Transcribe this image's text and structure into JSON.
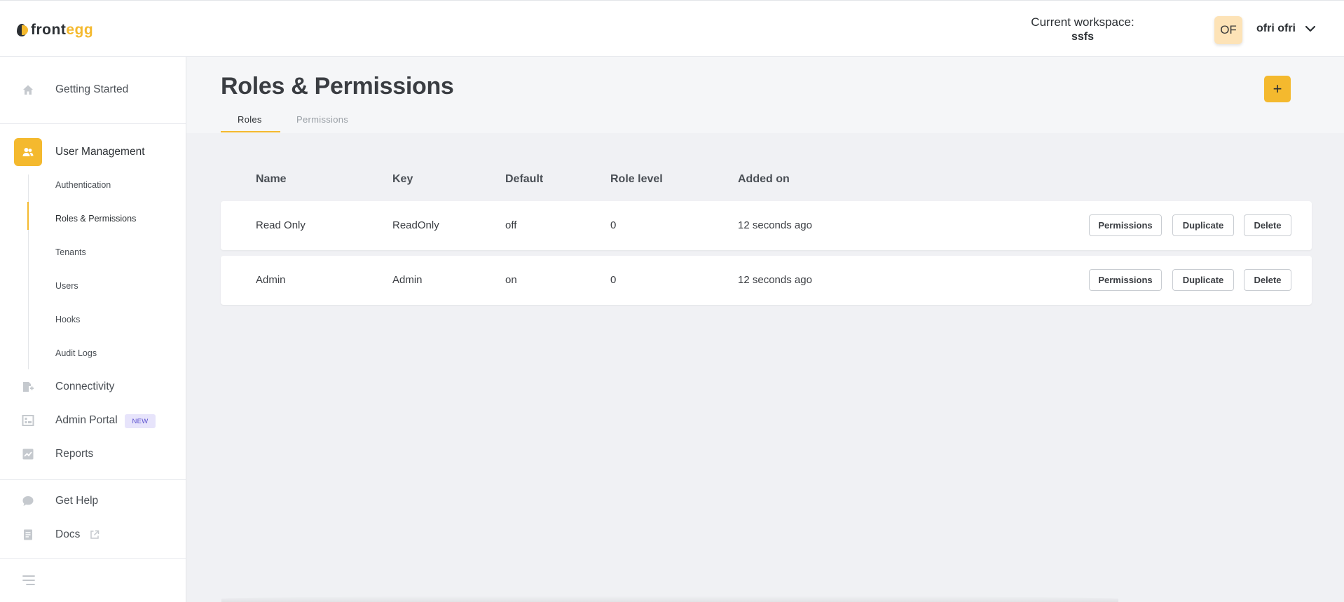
{
  "app": {
    "logo_text_1": "front",
    "logo_text_2": "egg"
  },
  "header": {
    "workspace_label": "Current workspace:",
    "workspace_name": "ssfs",
    "avatar_initials": "OF",
    "username": "ofri ofri"
  },
  "sidebar": {
    "getting_started": "Getting Started",
    "user_management": "User Management",
    "sub_items": [
      "Authentication",
      "Roles & Permissions",
      "Tenants",
      "Users",
      "Hooks",
      "Audit Logs"
    ],
    "connectivity": "Connectivity",
    "admin_portal": "Admin Portal",
    "new_badge": "NEW",
    "reports": "Reports",
    "get_help": "Get Help",
    "docs": "Docs"
  },
  "page": {
    "title": "Roles & Permissions",
    "add_label": "+",
    "tabs": [
      {
        "label": "Roles",
        "active": true
      },
      {
        "label": "Permissions",
        "active": false
      }
    ]
  },
  "table": {
    "columns": [
      "Name",
      "Key",
      "Default",
      "Role level",
      "Added on"
    ],
    "rows": [
      {
        "name": "Read Only",
        "key": "ReadOnly",
        "default": "off",
        "role_level": "0",
        "added_on": "12 seconds ago"
      },
      {
        "name": "Admin",
        "key": "Admin",
        "default": "on",
        "role_level": "0",
        "added_on": "12 seconds ago"
      }
    ],
    "actions": {
      "permissions": "Permissions",
      "duplicate": "Duplicate",
      "delete": "Delete"
    }
  },
  "colors": {
    "accent": "#f4b92e",
    "new_badge_bg": "#e7e4fb",
    "new_badge_text": "#5a4fcf",
    "avatar_bg": "#fde3b7"
  }
}
